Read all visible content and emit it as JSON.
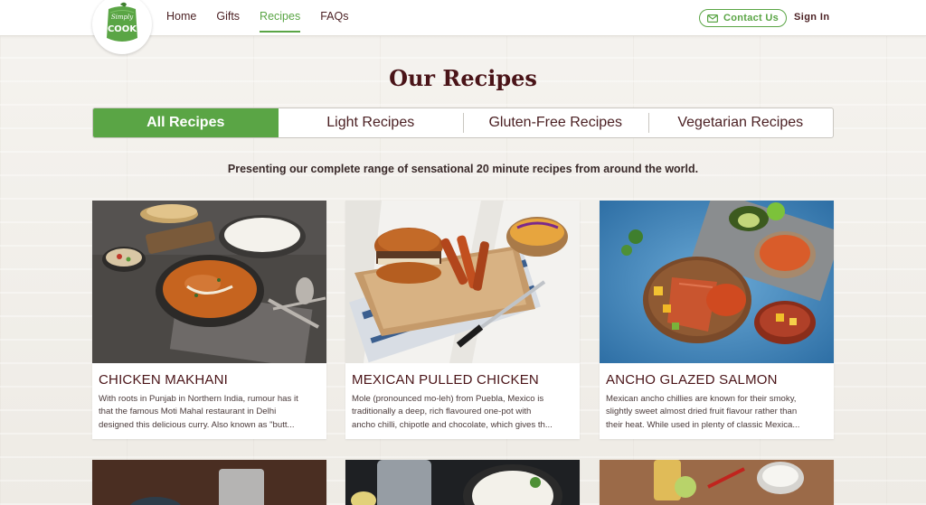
{
  "header": {
    "logo": {
      "line1": "Simply",
      "line2": "COOK"
    },
    "nav": [
      {
        "label": "Home",
        "active": false
      },
      {
        "label": "Gifts",
        "active": false
      },
      {
        "label": "Recipes",
        "active": true
      },
      {
        "label": "FAQs",
        "active": false
      }
    ],
    "contact_label": "Contact Us",
    "signin_label": "Sign In"
  },
  "page_title": "Our Recipes",
  "tabs": [
    {
      "label": "All Recipes",
      "active": true
    },
    {
      "label": "Light Recipes",
      "active": false
    },
    {
      "label": "Gluten-Free Recipes",
      "active": false
    },
    {
      "label": "Vegetarian Recipes",
      "active": false
    }
  ],
  "subtitle": "Presenting our complete range of sensational 20 minute recipes from around the world.",
  "cards": [
    {
      "title": "CHICKEN MAKHANI",
      "lines": [
        "With roots in Punjab in Northern India, rumour has it",
        "that the famous Moti Mahal restaurant in Delhi",
        "designed this delicious curry. Also known as \"butt..."
      ]
    },
    {
      "title": "MEXICAN PULLED CHICKEN",
      "lines": [
        "Mole (pronounced mo-leh) from Puebla, Mexico is",
        "traditionally a deep, rich flavoured one-pot with",
        "ancho chilli, chipotle and chocolate, which gives th..."
      ]
    },
    {
      "title": "ANCHO GLAZED SALMON",
      "lines": [
        "Mexican ancho chillies are known for their smoky,",
        "slightly sweet almost dried fruit flavour rather than",
        "their heat. While used in plenty of classic Mexica..."
      ]
    }
  ],
  "colors": {
    "brand_green": "#5aa545",
    "title_maroon": "#4a1418"
  }
}
